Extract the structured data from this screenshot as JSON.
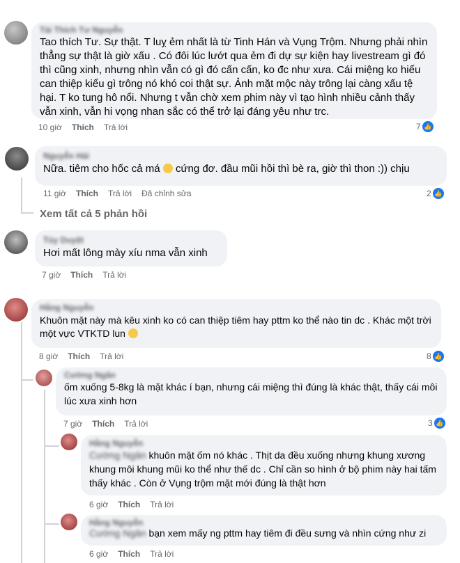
{
  "comments": [
    {
      "author": "Tài Thích Tư Nguyễn",
      "text": "Tao thích Tư. Sự thật. T luỵ ẻm nhất là từ Tinh Hán và Vụng Trộm. Nhưng phải nhìn thẳng sự thật là giờ xấu . Có đôi lúc lướt qua ẻm đi dự sự kiện hay livestream gì đó thì cũng xinh, nhưng nhìn vẫn có gì đó cấn cấn, ko đc như xưa. Cái miệng ko hiểu can thiệp kiểu gì trông nó khó coi thật sự. Ảnh mặt mộc này trông lại càng xấu tệ hại. T ko tung hô nổi. Nhưng t vẫn chờ xem phim này vì tạo hình nhiều cảnh thấy vẫn xinh, vẫn hi vọng nhan sắc có thể trở lại đáng yêu như trc.",
      "time": "10 giờ",
      "like": "Thích",
      "reply": "Trả lời",
      "reactions": "7"
    },
    {
      "author": "Nguyễn Hải",
      "text": "Nữa. tiêm cho hốc cả má  cứng đơ. đầu mũi hồi thì bè ra, giờ thì thon :)) chịu",
      "time": "11 giờ",
      "like": "Thích",
      "reply": "Trả lời",
      "edited": "Đã chỉnh sửa",
      "reactions": "2"
    },
    {
      "author": "Tùy Duyệt",
      "text": "Hơi mất lông mày xíu nma vẫn xinh",
      "time": "7 giờ",
      "like": "Thích",
      "reply": "Trả lời"
    },
    {
      "author": "Hằng Nguyễn",
      "text": "Khuôn mặt này mà kêu xinh ko có can thiệp tiêm hay pttm ko thể nào tin dc . Khác một trời một vực VTKTD lun ",
      "time": "8 giờ",
      "like": "Thích",
      "reply": "Trả lời",
      "reactions": "8"
    },
    {
      "author": "Cường Ngân",
      "text": "ốm xuống 5-8kg là mặt khác í bạn, nhưng cái miệng thì đúng là khác thật, thấy cái môi lúc xưa xinh hơn",
      "time": "7 giờ",
      "like": "Thích",
      "reply": "Trả lời",
      "reactions": "3"
    },
    {
      "author": "Hằng Nguyễn",
      "mention": "Cường Ngân",
      "text": "khuôn mặt ốm nó khác . Thịt da đều xuống nhưng khung xương khung môi khung mũi ko thể như thế dc . Chỉ cần so hình ở bộ phim này hai tấm thấy khác . Còn ở Vụng trộm mặt mới đúng là thật hơn",
      "time": "6 giờ",
      "like": "Thích",
      "reply": "Trả lời"
    },
    {
      "author": "Hằng Nguyễn",
      "mention": "Cường Ngân",
      "text": "bạn xem mấy ng pttm hay tiêm đi đều sưng và nhìn cứng như zi",
      "time": "6 giờ",
      "like": "Thích",
      "reply": "Trả lời"
    }
  ],
  "view_more": "Xem tất cả 5 phản hồi",
  "colors": {
    "bubble": "#f0f2f5",
    "meta": "#65676b",
    "like_blue": "#1877f2"
  }
}
